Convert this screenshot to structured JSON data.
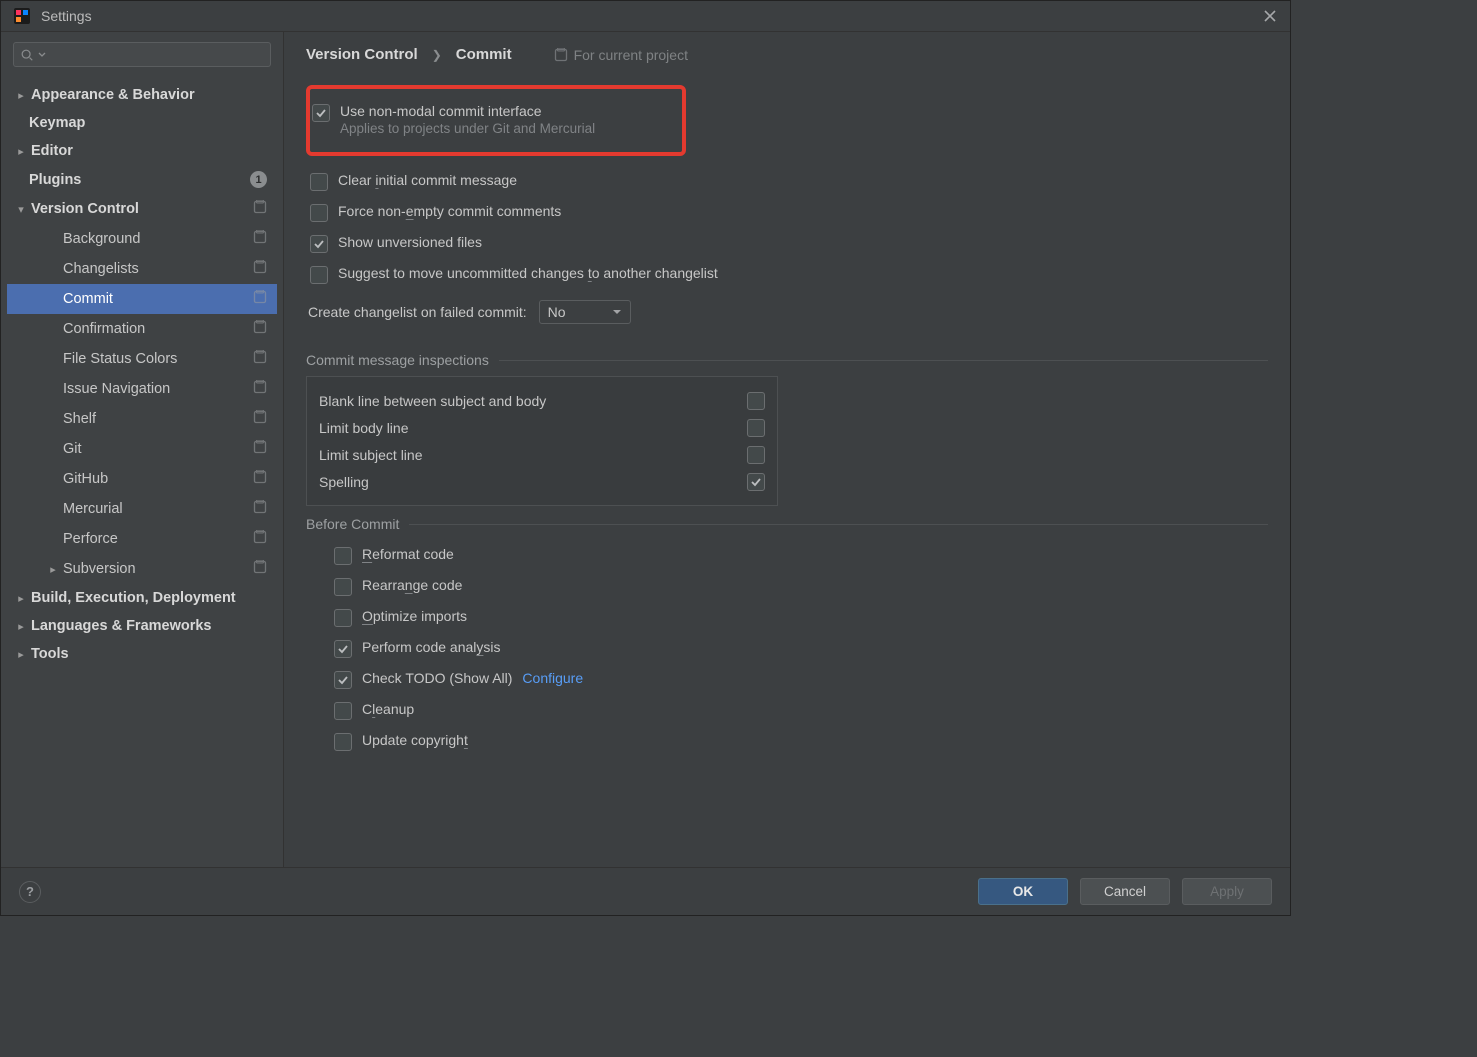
{
  "title": "Settings",
  "search_placeholder": "",
  "sidebar": {
    "items": [
      {
        "label": "Appearance & Behavior",
        "expandable": true,
        "expanded": false,
        "bold": true,
        "indent": 1
      },
      {
        "label": "Keymap",
        "bold": true,
        "indent": 1
      },
      {
        "label": "Editor",
        "expandable": true,
        "expanded": false,
        "bold": true,
        "indent": 1
      },
      {
        "label": "Plugins",
        "bold": true,
        "indent": 1,
        "badge": "1"
      },
      {
        "label": "Version Control",
        "expandable": true,
        "expanded": true,
        "bold": true,
        "indent": 1,
        "proj": true
      },
      {
        "label": "Background",
        "indent": 2,
        "proj": true
      },
      {
        "label": "Changelists",
        "indent": 2,
        "proj": true
      },
      {
        "label": "Commit",
        "indent": 2,
        "proj": true,
        "selected": true
      },
      {
        "label": "Confirmation",
        "indent": 2,
        "proj": true
      },
      {
        "label": "File Status Colors",
        "indent": 2,
        "proj": true
      },
      {
        "label": "Issue Navigation",
        "indent": 2,
        "proj": true
      },
      {
        "label": "Shelf",
        "indent": 2,
        "proj": true
      },
      {
        "label": "Git",
        "indent": 2,
        "proj": true
      },
      {
        "label": "GitHub",
        "indent": 2,
        "proj": true
      },
      {
        "label": "Mercurial",
        "indent": 2,
        "proj": true
      },
      {
        "label": "Perforce",
        "indent": 2,
        "proj": true
      },
      {
        "label": "Subversion",
        "expandable": true,
        "expanded": false,
        "indent": 2,
        "proj": true
      },
      {
        "label": "Build, Execution, Deployment",
        "expandable": true,
        "expanded": false,
        "bold": true,
        "indent": 1
      },
      {
        "label": "Languages & Frameworks",
        "expandable": true,
        "expanded": false,
        "bold": true,
        "indent": 1
      },
      {
        "label": "Tools",
        "expandable": true,
        "expanded": false,
        "bold": true,
        "indent": 1
      }
    ]
  },
  "breadcrumb": {
    "root": "Version Control",
    "leaf": "Commit",
    "scope": "For current project"
  },
  "options": {
    "nonmodal": {
      "label": "Use non-modal commit interface",
      "sub": "Applies to projects under Git and Mercurial",
      "checked": true
    },
    "clear_initial": {
      "label_pre": "Clear ",
      "label_u": "i",
      "label_post": "nitial commit message",
      "checked": false
    },
    "force_nonempty": {
      "label_pre": "Force non-",
      "label_u": "e",
      "label_post": "mpty commit comments",
      "checked": false
    },
    "show_unversioned": {
      "label": "Show unversioned files",
      "checked": true
    },
    "suggest_move": {
      "label_pre": "Suggest to move uncommitted changes ",
      "label_u": "t",
      "label_post": "o another changelist",
      "checked": false
    },
    "create_changelist_label": "Create changelist on failed commit:",
    "create_changelist_value": "No"
  },
  "inspections": {
    "title": "Commit message inspections",
    "rows": [
      {
        "label": "Blank line between subject and body",
        "checked": false
      },
      {
        "label": "Limit body line",
        "checked": false
      },
      {
        "label": "Limit subject line",
        "checked": false
      },
      {
        "label": "Spelling",
        "checked": true
      }
    ]
  },
  "before": {
    "title": "Before Commit",
    "rows": [
      {
        "pre": "",
        "u": "R",
        "post": "eformat code",
        "checked": false
      },
      {
        "pre": "Rearra",
        "u": "n",
        "post": "ge code",
        "checked": false
      },
      {
        "pre": "",
        "u": "O",
        "post": "ptimize imports",
        "checked": false
      },
      {
        "pre": "Perform code anal",
        "u": "y",
        "post": "sis",
        "checked": true
      },
      {
        "pre": "Check TODO (Show All)",
        "u": "",
        "post": "",
        "checked": true,
        "link": "Configure"
      },
      {
        "pre": "C",
        "u": "l",
        "post": "eanup",
        "checked": false
      },
      {
        "pre": "Update copyrigh",
        "u": "t",
        "post": "",
        "checked": false
      }
    ]
  },
  "footer": {
    "ok": "OK",
    "cancel": "Cancel",
    "apply": "Apply"
  }
}
